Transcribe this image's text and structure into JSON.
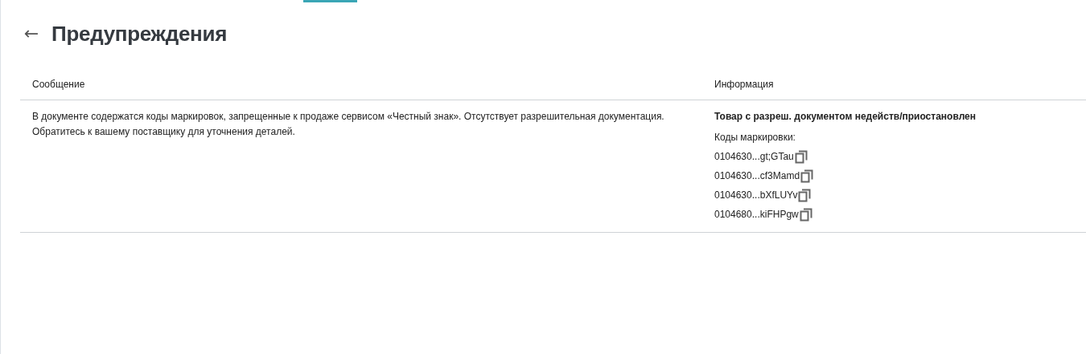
{
  "header": {
    "back": "←",
    "title": "Предупреждения"
  },
  "table": {
    "columns": [
      "Сообщение",
      "Информация"
    ],
    "rows": [
      {
        "message": "В документе содержатся коды маркировок, запрещенные к продаже сервисом «Честный знак». Отсутствует разрешительная документация. Обратитесь к вашему поставщику для уточнения деталей.",
        "info_title": "Товар с разреш. документом недейств/приостановлен",
        "codes_label": "Коды маркировки:",
        "codes": [
          "0104630...gt;GTau",
          "0104630...cf3Mamd",
          "0104630...bXfLUYv",
          "0104680...kiFHPgw"
        ]
      }
    ]
  }
}
